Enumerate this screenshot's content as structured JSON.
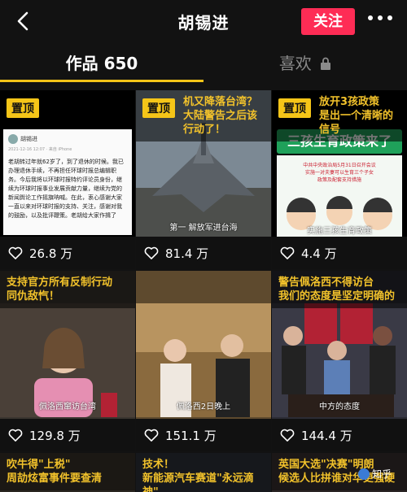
{
  "header": {
    "title": "胡锡进",
    "follow_label": "关注"
  },
  "tabs": {
    "works_label": "作品 650",
    "likes_label": "喜欢"
  },
  "pin_label": "置顶",
  "grid": [
    {
      "pinned": true,
      "likes": "26.8 万",
      "card_user": "胡锡进",
      "card_date": "2021-12-16 12:07 · 来自 iPhone",
      "card_text": "老胡转过年就62岁了，到了退休的时候。我已办理退休手续，不再担任环球时报总编辑职务。今后我将以环球时报特约评论员身份，继续为环球时报事业发展贡献力量，继续为党的新闻舆论工作摇旗呐喊。在此，衷心感谢大家一直以来对环球时报的支持、关注，感谢对我的鼓励，以及批评鞭策。老胡给大家作揖了"
    },
    {
      "pinned": true,
      "headline": "机又降落台湾？\n大陆警告之后该行动了！",
      "subtitle": "第一  解放军进台海",
      "likes": "81.4 万"
    },
    {
      "pinned": true,
      "headline": "放开3孩政策\n是出一个清晰的信号",
      "banner": "三孩生育政策来了",
      "info_text": "中共中央政治局5月31日召开会议\n实施一对夫妻可以生育三个子女\n政策及配套支持措施",
      "subtitle": "实施三孩生育政策",
      "likes": "4.4 万"
    },
    {
      "headline": "支持官方所有反制行动\n同仇敌忾！",
      "subtitle": "佩洛西窜访台湾",
      "likes": "129.8 万"
    },
    {
      "subtitle": "佩洛西2日晚上",
      "likes": "151.1 万"
    },
    {
      "headline": "警告佩洛西不得访台\n我们的态度是坚定明确的",
      "subtitle": "中方的态度",
      "likes": "144.4 万"
    },
    {
      "headline": "吹牛得\"上税\"\n周劼炫富事件要查清"
    },
    {
      "headline": "技术！\n新能源汽车赛道\"永远滴神\""
    },
    {
      "headline": "英国大选\"决赛\"明朗\n候选人比拼谁对华更强硬"
    }
  ],
  "watermark": "知乎",
  "colors": {
    "accent_red": "#fe2c55",
    "pin_yellow": "#f5c518",
    "headline_gold": "#f2c22b",
    "background": "#121212"
  },
  "icons": [
    "back-arrow-icon",
    "more-dots-icon",
    "lock-icon",
    "heart-icon"
  ]
}
